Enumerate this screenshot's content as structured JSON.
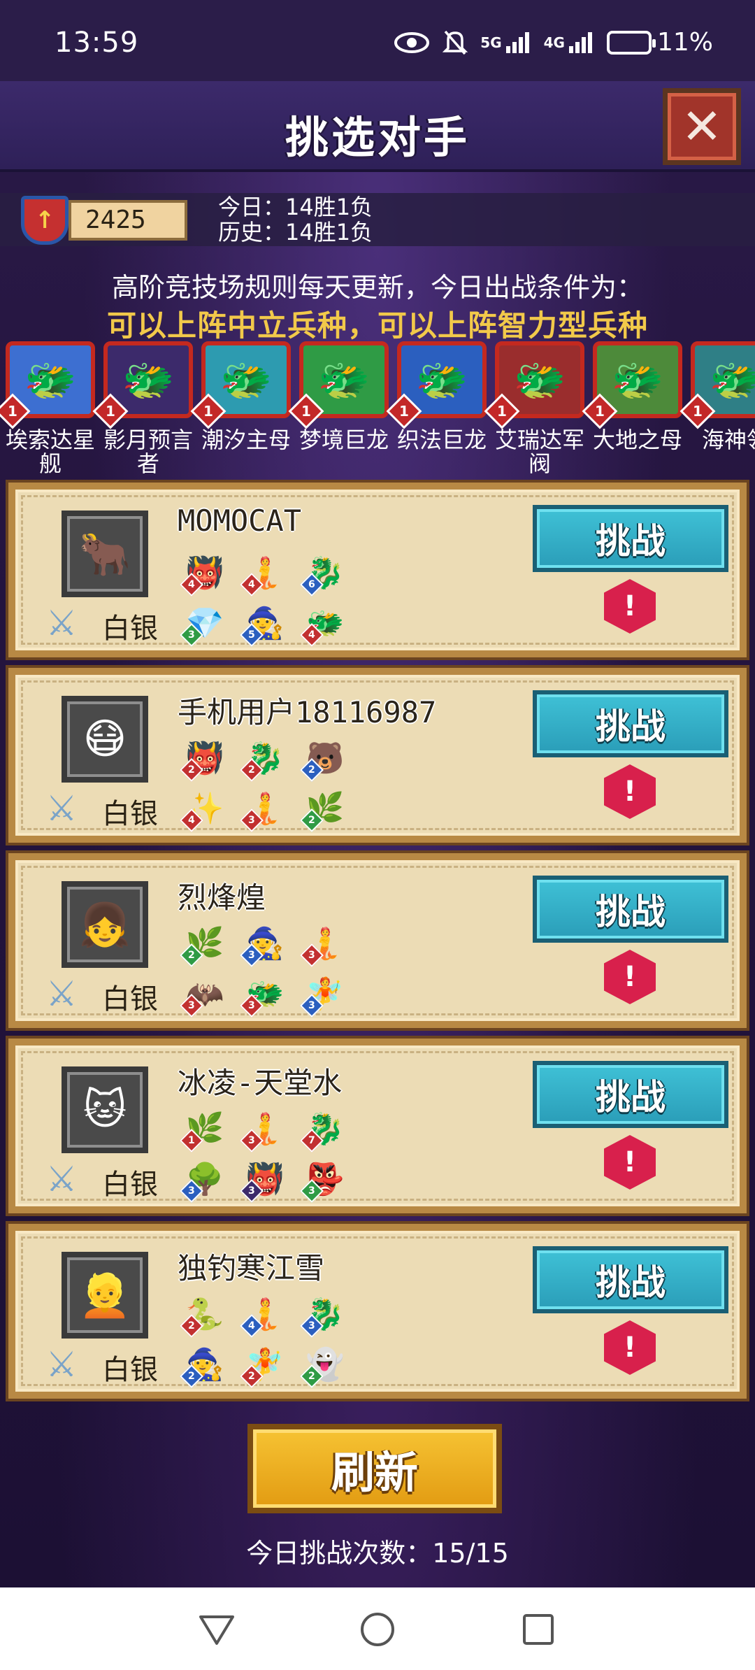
{
  "status_bar": {
    "time": "13:59",
    "network_5g": "5G",
    "network_4g": "4G",
    "battery": "11%"
  },
  "header": {
    "title": "挑选对手",
    "close_label": "✕"
  },
  "stats": {
    "score": "2425",
    "today": "今日：14胜1负",
    "history": "历史：14胜1负"
  },
  "rules": {
    "line1": "高阶竞技场规则每天更新，今日出战条件为：",
    "line2": "可以上阵中立兵种，可以上阵智力型兵种"
  },
  "troops": [
    {
      "level": "1",
      "name": "埃索达星舰",
      "color": "#3d6fd1"
    },
    {
      "level": "1",
      "name": "影月预言者",
      "color": "#3c2a6b"
    },
    {
      "level": "1",
      "name": "潮汐主母",
      "color": "#2d9bb0"
    },
    {
      "level": "1",
      "name": "梦境巨龙",
      "color": "#2f9b45"
    },
    {
      "level": "1",
      "name": "织法巨龙",
      "color": "#2b5fbf"
    },
    {
      "level": "1",
      "name": "艾瑞达军阀",
      "color": "#9a2d2d"
    },
    {
      "level": "1",
      "name": "大地之母",
      "color": "#4d8a3a"
    },
    {
      "level": "1",
      "name": "海神领",
      "color": "#2f7f86"
    }
  ],
  "opponents": [
    {
      "name": "MOMOCAT",
      "rank": "白银",
      "avatar_icon": "🐂",
      "units": [
        {
          "level": "4",
          "color": "#c23030",
          "icon": "👹"
        },
        {
          "level": "4",
          "color": "#c23030",
          "icon": "🧜"
        },
        {
          "level": "6",
          "color": "#2b5fbf",
          "icon": "🐉"
        },
        {
          "level": "3",
          "color": "#2f9b45",
          "icon": "💎"
        },
        {
          "level": "5",
          "color": "#2b5fbf",
          "icon": "🧙"
        },
        {
          "level": "4",
          "color": "#c23030",
          "icon": "🐲"
        }
      ],
      "challenge_label": "挑战"
    },
    {
      "name": "手机用户18116987",
      "rank": "白银",
      "avatar_icon": "😷",
      "units": [
        {
          "level": "2",
          "color": "#c23030",
          "icon": "👹"
        },
        {
          "level": "2",
          "color": "#c23030",
          "icon": "🐉"
        },
        {
          "level": "2",
          "color": "#2b5fbf",
          "icon": "🐻"
        },
        {
          "level": "4",
          "color": "#c23030",
          "icon": "✨"
        },
        {
          "level": "3",
          "color": "#c23030",
          "icon": "🧜"
        },
        {
          "level": "2",
          "color": "#2f9b45",
          "icon": "🌿"
        }
      ],
      "challenge_label": "挑战"
    },
    {
      "name": "烈烽煌",
      "rank": "白银",
      "avatar_icon": "👧",
      "units": [
        {
          "level": "2",
          "color": "#2f9b45",
          "icon": "🌿"
        },
        {
          "level": "3",
          "color": "#2b5fbf",
          "icon": "🧙"
        },
        {
          "level": "3",
          "color": "#c23030",
          "icon": "🧜"
        },
        {
          "level": "3",
          "color": "#c23030",
          "icon": "🦇"
        },
        {
          "level": "3",
          "color": "#c23030",
          "icon": "🐲"
        },
        {
          "level": "3",
          "color": "#2b5fbf",
          "icon": "🧚"
        }
      ],
      "challenge_label": "挑战"
    },
    {
      "name": "冰凌-天堂水",
      "rank": "白银",
      "avatar_icon": "🐱",
      "units": [
        {
          "level": "1",
          "color": "#c23030",
          "icon": "🌿"
        },
        {
          "level": "3",
          "color": "#c23030",
          "icon": "🧜"
        },
        {
          "level": "7",
          "color": "#c23030",
          "icon": "🐉"
        },
        {
          "level": "3",
          "color": "#2b5fbf",
          "icon": "🌳"
        },
        {
          "level": "3",
          "color": "#3c2a6b",
          "icon": "👹"
        },
        {
          "level": "3",
          "color": "#2f9b45",
          "icon": "👺"
        }
      ],
      "challenge_label": "挑战"
    },
    {
      "name": "独钓寒江雪",
      "rank": "白银",
      "avatar_icon": "👱",
      "units": [
        {
          "level": "2",
          "color": "#c23030",
          "icon": "🐍"
        },
        {
          "level": "4",
          "color": "#2b5fbf",
          "icon": "🧜"
        },
        {
          "level": "3",
          "color": "#2b5fbf",
          "icon": "🐉"
        },
        {
          "level": "2",
          "color": "#2b5fbf",
          "icon": "🧙"
        },
        {
          "level": "2",
          "color": "#c23030",
          "icon": "🧚"
        },
        {
          "level": "2",
          "color": "#2f9b45",
          "icon": "👻"
        }
      ],
      "challenge_label": "挑战"
    }
  ],
  "refresh_label": "刷新",
  "daily_count": "今日挑战次数：15/15"
}
